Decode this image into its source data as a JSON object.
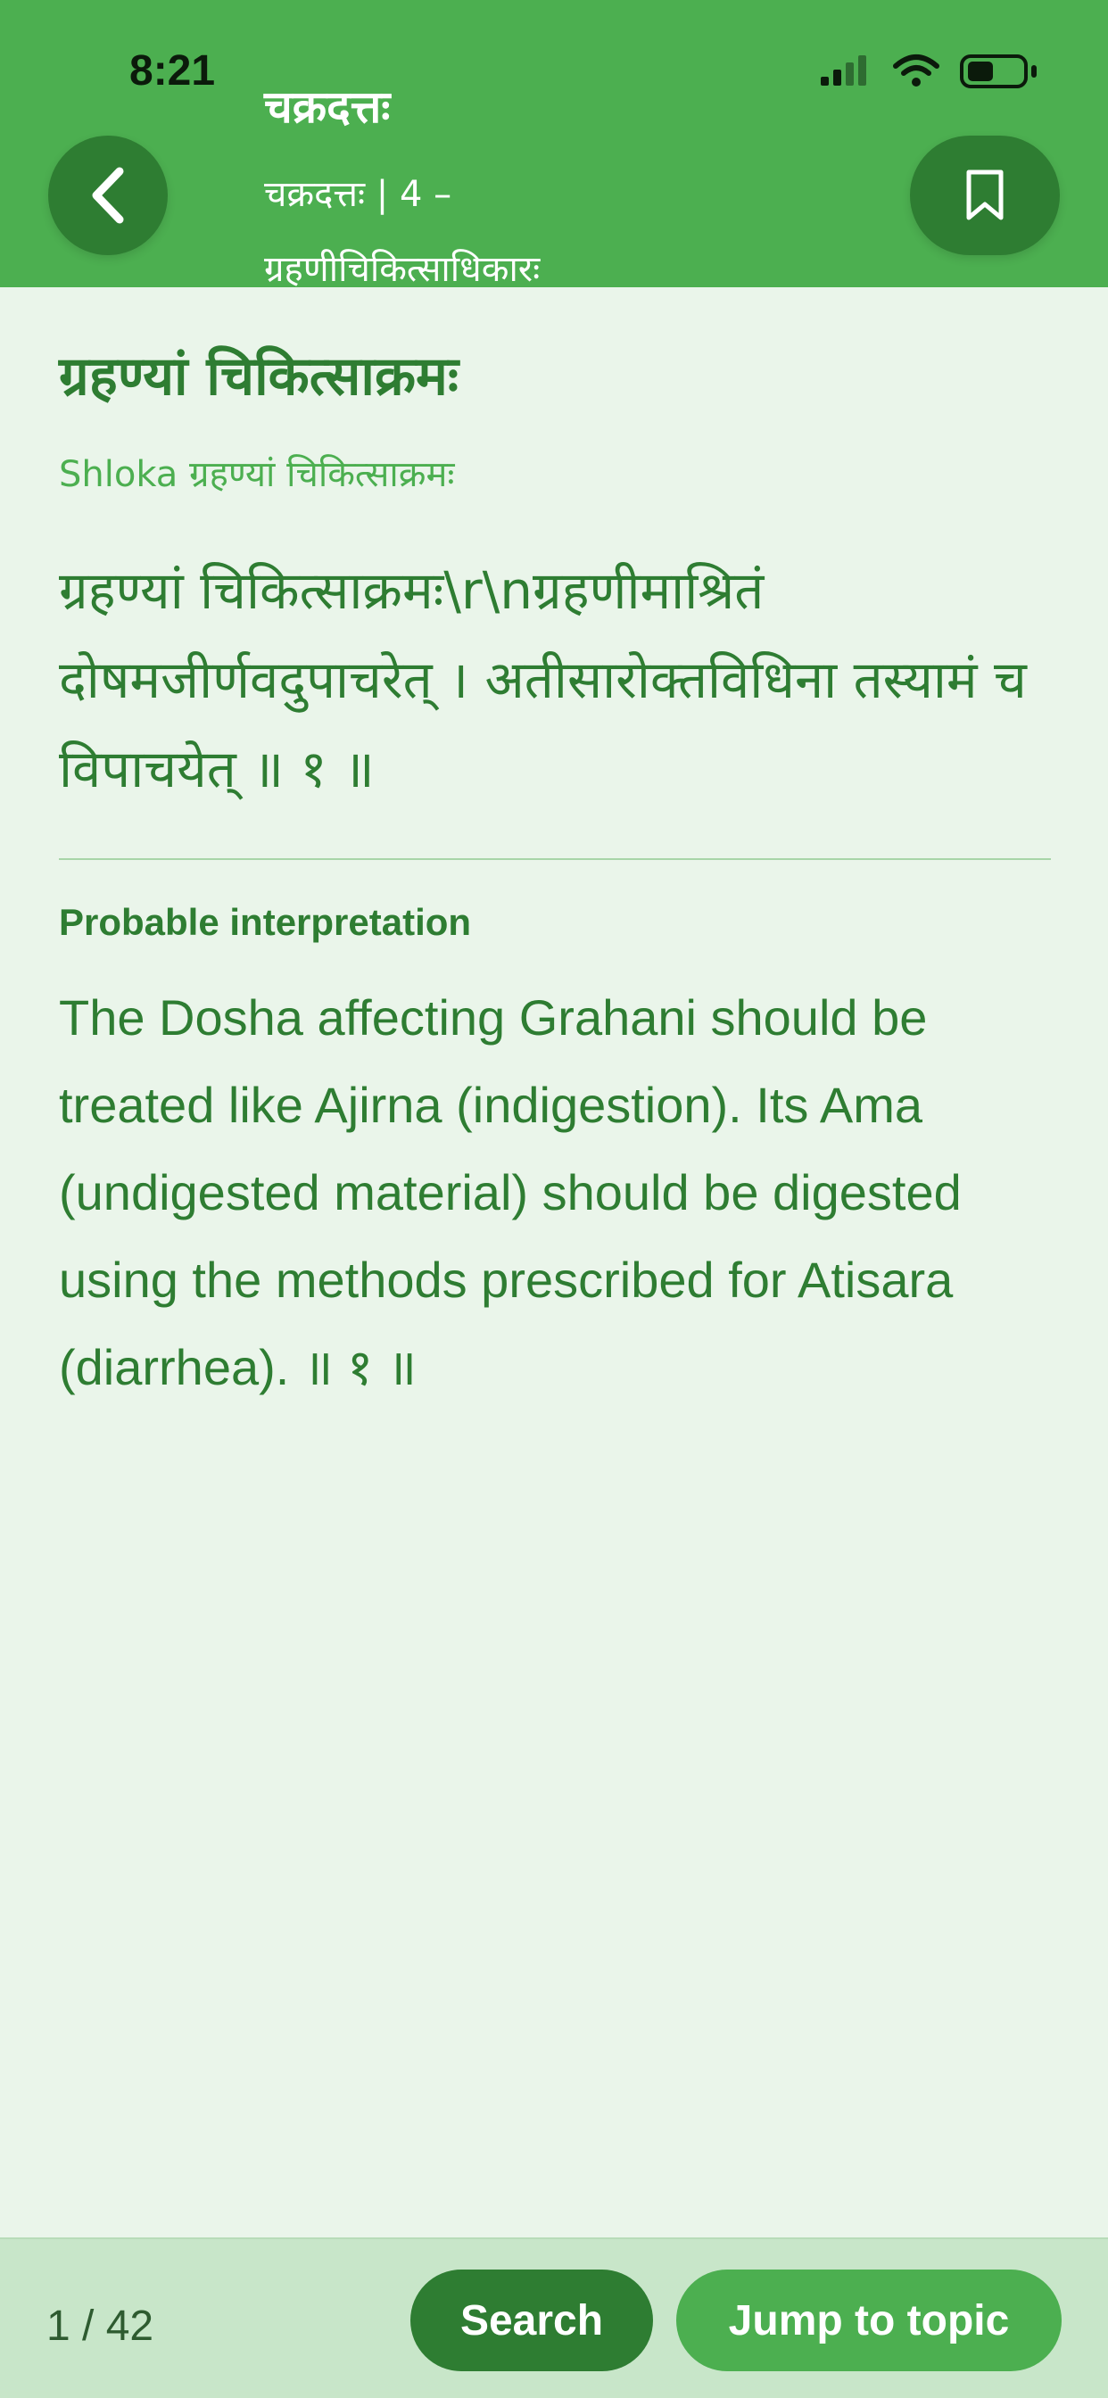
{
  "status_bar": {
    "time": "8:21",
    "icons": [
      "signal-icon",
      "wifi-icon",
      "battery-icon"
    ]
  },
  "header": {
    "title": "चक्रदत्तः",
    "subtitle": "चक्रदत्तः | 4 – ग्रहणीचिकित्साधिकारः",
    "back_icon": "chevron-left-icon",
    "bookmark_icon": "bookmark-icon"
  },
  "content": {
    "topic_title": "ग्रहण्यां चिकित्साक्रमः",
    "shloka_label": "Shloka ग्रहण्यां चिकित्साक्रमः",
    "shloka_text": "ग्रहण्यां चिकित्साक्रमः\\r\\nग्रहणीमाश्रितं दोषमजीर्णवदुपाचरेत् । अतीसारोक्तविधिना तस्यामं च विपाचयेत् ॥ १ ॥",
    "interpretation_label": "Probable interpretation",
    "interpretation_text": "The Dosha affecting Grahani should be treated like Ajirna (indigestion). Its Ama (undigested material) should be digested using the methods prescribed for Atisara (diarrhea). ॥ १ ॥"
  },
  "footer": {
    "page_counter": "1 / 42",
    "search_label": "Search",
    "jump_label": "Jump to topic"
  },
  "colors": {
    "header_bg": "#4caf50",
    "dark_green": "#2e7d32",
    "page_bg": "#eaf5ea",
    "footer_bg": "#c8e6c9"
  }
}
